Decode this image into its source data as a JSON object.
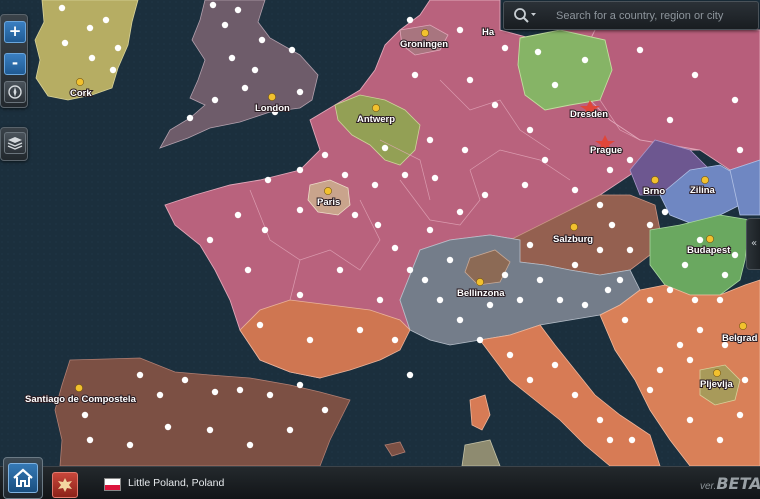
{
  "search": {
    "placeholder": "Search for a country, region or city",
    "icon": "magnifier-dropdown-icon"
  },
  "zoom": {
    "in_label": "+",
    "out_label": "-"
  },
  "collapse_label": "«",
  "cities": {
    "cork": "Cork",
    "london": "London",
    "groningen": "Groningen",
    "hamburg": "Ha",
    "antwerp": "Antwerp",
    "dresden": "Dresden",
    "prague": "Prague",
    "paris": "Paris",
    "brno": "Brno",
    "zilina": "Zilina",
    "salzburg": "Salzburg",
    "budapest": "Budapest",
    "bellinzona": "Bellinzona",
    "belgrade": "Belgrad",
    "pljevlja": "Pljevlja",
    "santiago": "Santiago de Compostela"
  },
  "bottom_bar": {
    "location": "Little Poland, Poland",
    "version_prefix": "ver.",
    "version_name": "BETA"
  },
  "colors": {
    "sea": "#1b2f3d",
    "france_empire": "#b9627d",
    "britain": "#6e5c6a",
    "ireland": "#b6ad63",
    "iberia": "#7c5044",
    "italy_south": "#d77b55",
    "alpine": "#747d8a",
    "belgium": "#93a055",
    "poland_green": "#86b466",
    "hungary": "#6aa860",
    "czech_purple": "#6d5790",
    "slovak_blue": "#6f87c2",
    "austria": "#946050",
    "balkans": "#d98058"
  }
}
